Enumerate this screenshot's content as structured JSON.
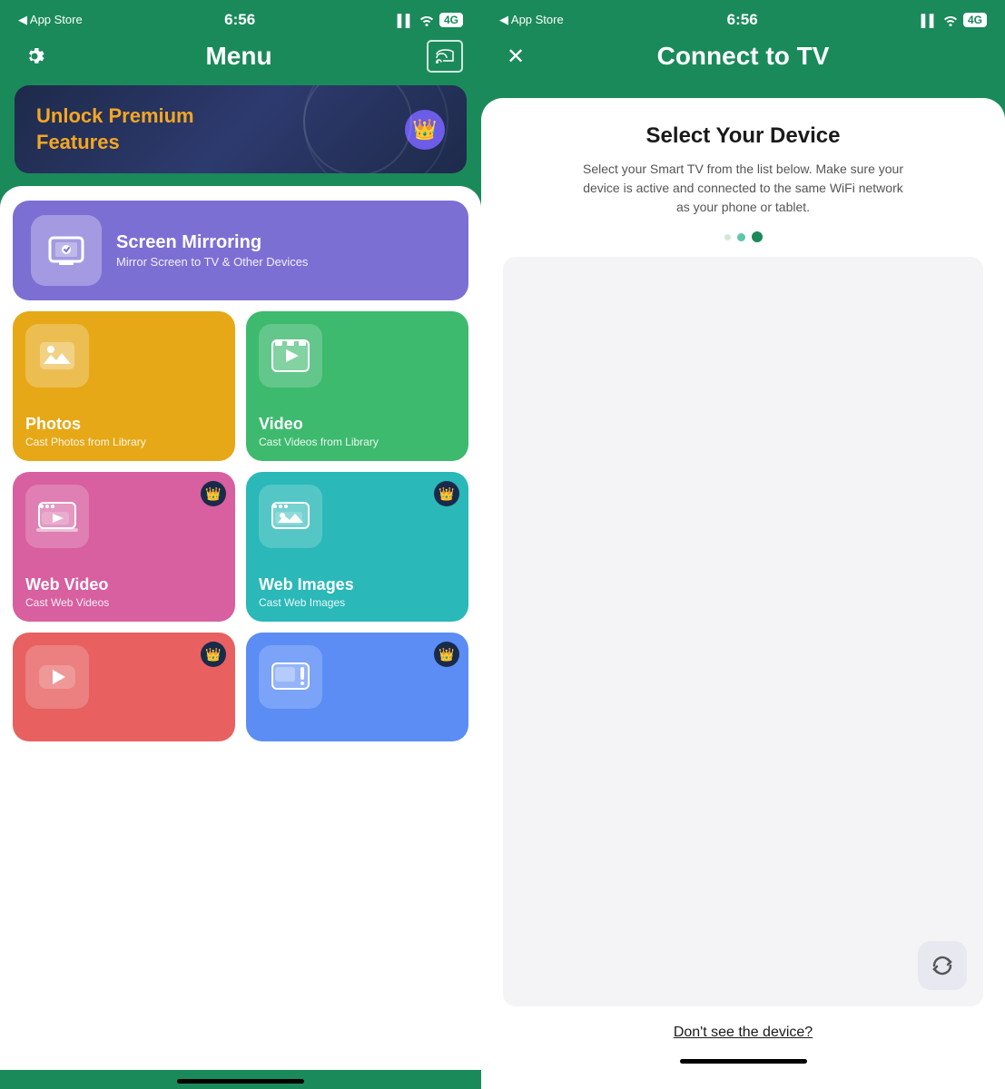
{
  "left": {
    "status": {
      "time": "6:56",
      "back_label": "◀ App Store"
    },
    "header": {
      "title": "Menu",
      "gear_icon": "⚙"
    },
    "premium_banner": {
      "line1": "Unlock ",
      "highlight": "Premium",
      "line2": "Features"
    },
    "menu_items": {
      "screen_mirroring": {
        "label": "Screen Mirroring",
        "sublabel": "Mirror Screen to TV & Other Devices"
      },
      "photos": {
        "label": "Photos",
        "sublabel": "Cast Photos from Library"
      },
      "video": {
        "label": "Video",
        "sublabel": "Cast Videos from Library"
      },
      "web_video": {
        "label": "Web Video",
        "sublabel": "Cast Web Videos",
        "premium": true
      },
      "web_images": {
        "label": "Web Images",
        "sublabel": "Cast Web Images",
        "premium": true
      },
      "youtube": {
        "label": "YouTube",
        "sublabel": "",
        "premium": true
      },
      "tv": {
        "label": "TV",
        "sublabel": "",
        "premium": true
      }
    }
  },
  "right": {
    "status": {
      "time": "6:56",
      "back_label": "◀ App Store"
    },
    "header": {
      "title": "Connect to TV",
      "close_btn": "✕"
    },
    "card": {
      "title": "Select Your Device",
      "description": "Select your Smart TV from the list below. Make sure your device is active and connected to the same WiFi network as your phone or tablet.",
      "dont_see_label": "Don't see the device?"
    }
  }
}
